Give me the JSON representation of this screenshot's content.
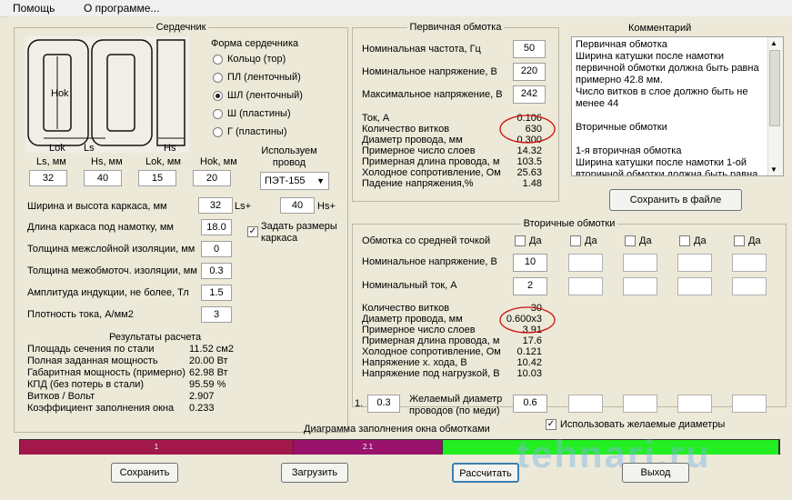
{
  "menu": {
    "help": "Помощь",
    "about": "О программе..."
  },
  "core": {
    "legend": "Сердечник",
    "diagram_labels": {
      "hok": "Hok",
      "lok": "Lok",
      "ls": "Ls",
      "hs": "Hs"
    },
    "shape_title": "Форма сердечника",
    "shapes": [
      "Кольцо  (тор)",
      "ПЛ  (ленточный)",
      "ШЛ  (ленточный)",
      "Ш  (пластины)",
      "Г (пластины)"
    ],
    "selected_shape": "ШЛ  (ленточный)",
    "dim_labels": [
      "Ls, мм",
      "Hs, мм",
      "Lok, мм",
      "Hok, мм"
    ],
    "dim_values": [
      "32",
      "40",
      "15",
      "20"
    ],
    "wire_title": "Используем\nпровод",
    "wire_value": "ПЭТ-155",
    "frame_label": "Ширина и высота каркаса, мм",
    "frame_ls": "32",
    "frame_ls_suffix": "Ls+",
    "frame_hs": "40",
    "frame_hs_suffix": "Hs+",
    "set_frame_label": "Задать размеры каркаса",
    "set_frame_checked": true,
    "params": [
      {
        "label": "Длина каркаса под намотку, мм",
        "value": "18.0"
      },
      {
        "label": "Толщина межслойной изоляции, мм",
        "value": "0"
      },
      {
        "label": "Толщина межобмоточ. изоляции, мм",
        "value": "0.3"
      },
      {
        "label": "Амплитуда индукции, не более, Тл",
        "value": "1.5"
      },
      {
        "label": "Плотность тока, А/мм2",
        "value": "3"
      }
    ],
    "results_title": "Результаты расчета",
    "results": [
      {
        "label": "Площадь сечения по стали",
        "value": "11.52 см2"
      },
      {
        "label": "Полная заданная мощность",
        "value": "20.00 Вт"
      },
      {
        "label": "Габаритная мощность (примерно)",
        "value": "62.98 Вт"
      },
      {
        "label": "КПД (без потерь в стали)",
        "value": "95.59 %"
      },
      {
        "label": "Витков / Вольт",
        "value": "2.907"
      },
      {
        "label": "Коэффициент заполнения окна",
        "value": "0.233"
      }
    ]
  },
  "primary": {
    "legend": "Первичная обмотка",
    "inputs": [
      {
        "label": "Номинальная частота, Гц",
        "value": "50"
      },
      {
        "label": "Номинальное напряжение, В",
        "value": "220"
      },
      {
        "label": "Максимальное напряжение, В",
        "value": "242"
      }
    ],
    "results": [
      {
        "label": "Ток, А",
        "value": "0.106"
      },
      {
        "label": "Количество витков",
        "value": "630"
      },
      {
        "label": "Диаметр провода, мм",
        "value": "0.300"
      },
      {
        "label": "Примерное число слоев",
        "value": "14.32"
      },
      {
        "label": "Примерная длина провода, м",
        "value": "103.5"
      },
      {
        "label": "Холодное сопротивление, Ом",
        "value": "25.63"
      },
      {
        "label": "Падение напряжения,%",
        "value": "1.48"
      }
    ]
  },
  "comment": {
    "legend": "Комментарий",
    "lines": [
      "       Первичная обмотка",
      "Ширина катушки после намотки",
      "первичной обмотки должна быть равна",
      "примерно 42.8 мм.",
      "Число витков в слое должно быть не",
      "менее 44",
      "",
      "         Вторичные обмотки",
      "",
      "      1-я вторичная обмотка",
      "Ширина катушки после намотки 1-ой",
      "вторичной обмотки должна быть равна"
    ],
    "save_file": "Сохранить в файле"
  },
  "secondary": {
    "legend": "Вторичные обмотки",
    "center_tap_label": "Обмотка со средней точкой",
    "da": "Да",
    "voltage_label": "Номинальное напряжение, В",
    "current_label": "Номинальный ток, А",
    "voltages": [
      "10",
      "",
      "",
      "",
      ""
    ],
    "currents": [
      "2",
      "",
      "",
      "",
      ""
    ],
    "results": [
      {
        "label": "Количество витков",
        "value": "30"
      },
      {
        "label": "Диаметр провода, мм",
        "value": "0.600x3"
      },
      {
        "label": "Примерное число слоев",
        "value": "3.91"
      },
      {
        "label": "Примерная длина провода, м",
        "value": "17.6"
      },
      {
        "label": "Холодное сопротивление, Ом",
        "value": "0.121"
      },
      {
        "label": "Напряжение х. хода, В",
        "value": "10.42"
      },
      {
        "label": "Напряжение под нагрузкой, В",
        "value": "10.03"
      }
    ]
  },
  "desired": {
    "index": "1.",
    "primary_value": "0.3",
    "label": "Желаемый диаметр\nпроводов  (по меди)",
    "values": [
      "0.6",
      "",
      "",
      "",
      ""
    ],
    "use_label": "Использовать желаемые диаметры",
    "use_checked": true
  },
  "fill": {
    "title": "Диаграмма заполнения окна обмотками",
    "segments": [
      {
        "label": "1",
        "fraction": 0.361,
        "color": "#a3184a"
      },
      {
        "label": "2.1",
        "fraction": 0.196,
        "color": "#99126b"
      },
      {
        "label": "",
        "fraction": 0.443,
        "color": "#22ee22"
      }
    ]
  },
  "buttons": {
    "save": "Сохранить",
    "load": "Загрузить",
    "calc": "Рассчитать",
    "exit": "Выход"
  },
  "watermark": "tehnari.ru",
  "colors": {
    "annotation": "#d01010",
    "calc_border": "#3c7fb1"
  }
}
